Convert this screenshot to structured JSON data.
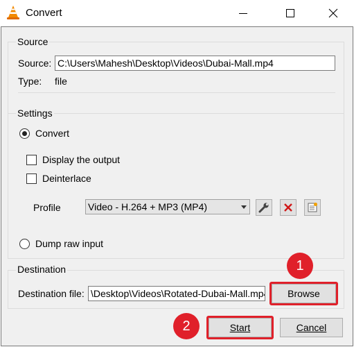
{
  "window": {
    "title": "Convert",
    "app_icon": "vlc-cone-icon",
    "minimize_icon": "minimize-icon",
    "maximize_icon": "maximize-icon",
    "close_icon": "close-icon"
  },
  "source": {
    "group_title": "Source",
    "source_label": "Source:",
    "source_value": "C:\\Users\\Mahesh\\Desktop\\Videos\\Dubai-Mall.mp4",
    "type_label": "Type:",
    "type_value": "file"
  },
  "settings": {
    "group_title": "Settings",
    "convert_label": "Convert",
    "convert_selected": true,
    "display_output_label": "Display the output",
    "display_output_checked": false,
    "deinterlace_label": "Deinterlace",
    "deinterlace_checked": false,
    "profile_label": "Profile",
    "profile_value": "Video - H.264 + MP3 (MP4)",
    "profile_tools": [
      "wrench-icon",
      "delete-icon",
      "new-profile-icon"
    ],
    "dump_raw_label": "Dump raw input",
    "dump_raw_selected": false
  },
  "destination": {
    "group_title": "Destination",
    "file_label": "Destination file:",
    "file_value": "\\Desktop\\Videos\\Rotated-Dubai-Mall.mp4",
    "browse_label": "Browse"
  },
  "footer": {
    "start_label": "Start",
    "cancel_label": "Cancel"
  },
  "annotations": {
    "step1": "1",
    "step2": "2",
    "color": "#e0202a"
  }
}
